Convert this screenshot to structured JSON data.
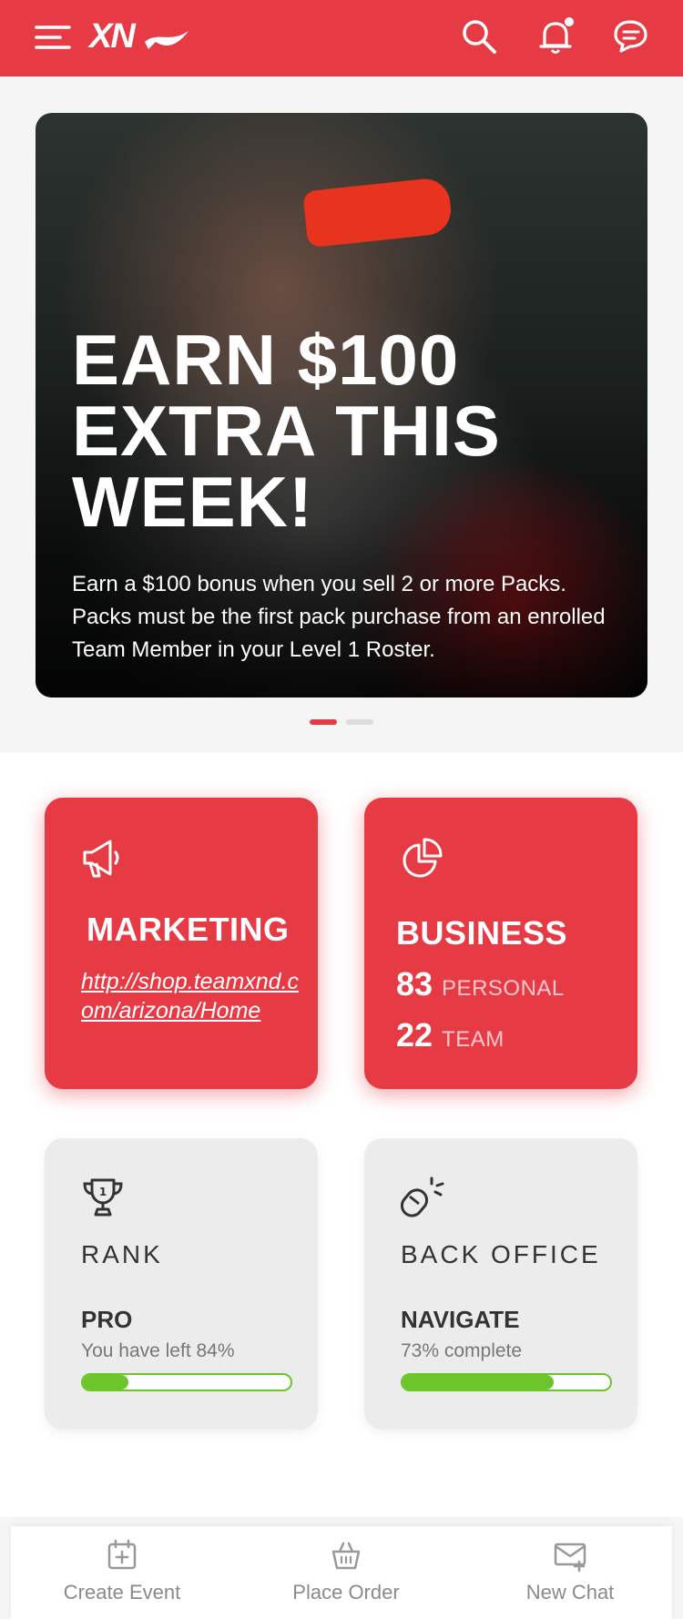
{
  "header": {
    "logo": "XN",
    "icons": [
      "menu-icon",
      "search-icon",
      "bell-icon",
      "chat-icon"
    ]
  },
  "banner": {
    "title": "EARN $100 EXTRA THIS WEEK!",
    "text": "Earn a $100 bonus when you sell 2 or more Packs. Packs must be the first pack purchase from an enrolled Team Member in your Level 1 Roster.",
    "slides": 2,
    "active_slide": 1
  },
  "cards": {
    "marketing": {
      "title": "MARKETING",
      "link": "http://shop.teamxnd.com/arizona/Home"
    },
    "business": {
      "title": "BUSINESS",
      "personal_count": "83",
      "personal_label": "PERSONAL",
      "team_count": "22",
      "team_label": "TEAM"
    },
    "rank": {
      "label": "RANK",
      "value": "PRO",
      "note": "You have left 84%",
      "progress": 0.22
    },
    "back_office": {
      "label": "BACK OFFICE",
      "value": "NAVIGATE",
      "note": "73% complete",
      "progress": 0.73
    }
  },
  "bottom_nav": [
    {
      "label": "Create Event",
      "icon": "calendar-plus-icon"
    },
    {
      "label": "Place Order",
      "icon": "basket-icon"
    },
    {
      "label": "New Chat",
      "icon": "mail-plus-icon"
    }
  ],
  "colors": {
    "brand_red": "#e63a45",
    "progress_green": "#6cc52a",
    "dot_inactive": "#dddddd"
  }
}
